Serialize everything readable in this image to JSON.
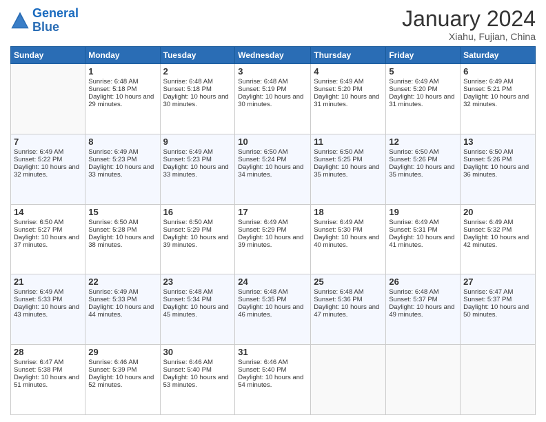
{
  "header": {
    "logo_line1": "General",
    "logo_line2": "Blue",
    "month": "January 2024",
    "location": "Xiahu, Fujian, China"
  },
  "days_of_week": [
    "Sunday",
    "Monday",
    "Tuesday",
    "Wednesday",
    "Thursday",
    "Friday",
    "Saturday"
  ],
  "weeks": [
    [
      {
        "day": "",
        "sunrise": "",
        "sunset": "",
        "daylight": ""
      },
      {
        "day": "1",
        "sunrise": "Sunrise: 6:48 AM",
        "sunset": "Sunset: 5:18 PM",
        "daylight": "Daylight: 10 hours and 29 minutes."
      },
      {
        "day": "2",
        "sunrise": "Sunrise: 6:48 AM",
        "sunset": "Sunset: 5:18 PM",
        "daylight": "Daylight: 10 hours and 30 minutes."
      },
      {
        "day": "3",
        "sunrise": "Sunrise: 6:48 AM",
        "sunset": "Sunset: 5:19 PM",
        "daylight": "Daylight: 10 hours and 30 minutes."
      },
      {
        "day": "4",
        "sunrise": "Sunrise: 6:49 AM",
        "sunset": "Sunset: 5:20 PM",
        "daylight": "Daylight: 10 hours and 31 minutes."
      },
      {
        "day": "5",
        "sunrise": "Sunrise: 6:49 AM",
        "sunset": "Sunset: 5:20 PM",
        "daylight": "Daylight: 10 hours and 31 minutes."
      },
      {
        "day": "6",
        "sunrise": "Sunrise: 6:49 AM",
        "sunset": "Sunset: 5:21 PM",
        "daylight": "Daylight: 10 hours and 32 minutes."
      }
    ],
    [
      {
        "day": "7",
        "sunrise": "Sunrise: 6:49 AM",
        "sunset": "Sunset: 5:22 PM",
        "daylight": "Daylight: 10 hours and 32 minutes."
      },
      {
        "day": "8",
        "sunrise": "Sunrise: 6:49 AM",
        "sunset": "Sunset: 5:23 PM",
        "daylight": "Daylight: 10 hours and 33 minutes."
      },
      {
        "day": "9",
        "sunrise": "Sunrise: 6:49 AM",
        "sunset": "Sunset: 5:23 PM",
        "daylight": "Daylight: 10 hours and 33 minutes."
      },
      {
        "day": "10",
        "sunrise": "Sunrise: 6:50 AM",
        "sunset": "Sunset: 5:24 PM",
        "daylight": "Daylight: 10 hours and 34 minutes."
      },
      {
        "day": "11",
        "sunrise": "Sunrise: 6:50 AM",
        "sunset": "Sunset: 5:25 PM",
        "daylight": "Daylight: 10 hours and 35 minutes."
      },
      {
        "day": "12",
        "sunrise": "Sunrise: 6:50 AM",
        "sunset": "Sunset: 5:26 PM",
        "daylight": "Daylight: 10 hours and 35 minutes."
      },
      {
        "day": "13",
        "sunrise": "Sunrise: 6:50 AM",
        "sunset": "Sunset: 5:26 PM",
        "daylight": "Daylight: 10 hours and 36 minutes."
      }
    ],
    [
      {
        "day": "14",
        "sunrise": "Sunrise: 6:50 AM",
        "sunset": "Sunset: 5:27 PM",
        "daylight": "Daylight: 10 hours and 37 minutes."
      },
      {
        "day": "15",
        "sunrise": "Sunrise: 6:50 AM",
        "sunset": "Sunset: 5:28 PM",
        "daylight": "Daylight: 10 hours and 38 minutes."
      },
      {
        "day": "16",
        "sunrise": "Sunrise: 6:50 AM",
        "sunset": "Sunset: 5:29 PM",
        "daylight": "Daylight: 10 hours and 39 minutes."
      },
      {
        "day": "17",
        "sunrise": "Sunrise: 6:49 AM",
        "sunset": "Sunset: 5:29 PM",
        "daylight": "Daylight: 10 hours and 39 minutes."
      },
      {
        "day": "18",
        "sunrise": "Sunrise: 6:49 AM",
        "sunset": "Sunset: 5:30 PM",
        "daylight": "Daylight: 10 hours and 40 minutes."
      },
      {
        "day": "19",
        "sunrise": "Sunrise: 6:49 AM",
        "sunset": "Sunset: 5:31 PM",
        "daylight": "Daylight: 10 hours and 41 minutes."
      },
      {
        "day": "20",
        "sunrise": "Sunrise: 6:49 AM",
        "sunset": "Sunset: 5:32 PM",
        "daylight": "Daylight: 10 hours and 42 minutes."
      }
    ],
    [
      {
        "day": "21",
        "sunrise": "Sunrise: 6:49 AM",
        "sunset": "Sunset: 5:33 PM",
        "daylight": "Daylight: 10 hours and 43 minutes."
      },
      {
        "day": "22",
        "sunrise": "Sunrise: 6:49 AM",
        "sunset": "Sunset: 5:33 PM",
        "daylight": "Daylight: 10 hours and 44 minutes."
      },
      {
        "day": "23",
        "sunrise": "Sunrise: 6:48 AM",
        "sunset": "Sunset: 5:34 PM",
        "daylight": "Daylight: 10 hours and 45 minutes."
      },
      {
        "day": "24",
        "sunrise": "Sunrise: 6:48 AM",
        "sunset": "Sunset: 5:35 PM",
        "daylight": "Daylight: 10 hours and 46 minutes."
      },
      {
        "day": "25",
        "sunrise": "Sunrise: 6:48 AM",
        "sunset": "Sunset: 5:36 PM",
        "daylight": "Daylight: 10 hours and 47 minutes."
      },
      {
        "day": "26",
        "sunrise": "Sunrise: 6:48 AM",
        "sunset": "Sunset: 5:37 PM",
        "daylight": "Daylight: 10 hours and 49 minutes."
      },
      {
        "day": "27",
        "sunrise": "Sunrise: 6:47 AM",
        "sunset": "Sunset: 5:37 PM",
        "daylight": "Daylight: 10 hours and 50 minutes."
      }
    ],
    [
      {
        "day": "28",
        "sunrise": "Sunrise: 6:47 AM",
        "sunset": "Sunset: 5:38 PM",
        "daylight": "Daylight: 10 hours and 51 minutes."
      },
      {
        "day": "29",
        "sunrise": "Sunrise: 6:46 AM",
        "sunset": "Sunset: 5:39 PM",
        "daylight": "Daylight: 10 hours and 52 minutes."
      },
      {
        "day": "30",
        "sunrise": "Sunrise: 6:46 AM",
        "sunset": "Sunset: 5:40 PM",
        "daylight": "Daylight: 10 hours and 53 minutes."
      },
      {
        "day": "31",
        "sunrise": "Sunrise: 6:46 AM",
        "sunset": "Sunset: 5:40 PM",
        "daylight": "Daylight: 10 hours and 54 minutes."
      },
      {
        "day": "",
        "sunrise": "",
        "sunset": "",
        "daylight": ""
      },
      {
        "day": "",
        "sunrise": "",
        "sunset": "",
        "daylight": ""
      },
      {
        "day": "",
        "sunrise": "",
        "sunset": "",
        "daylight": ""
      }
    ]
  ]
}
